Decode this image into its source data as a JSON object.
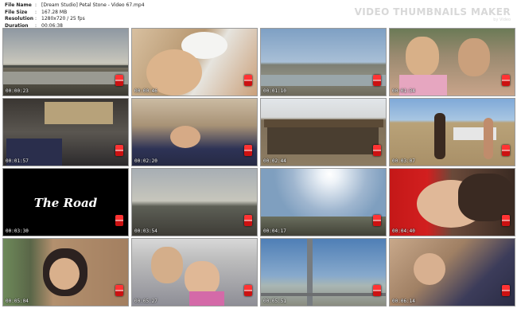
{
  "header": {
    "file_name_key": "File Name",
    "file_name_sep": ":",
    "file_name": "[Dream Studio] Petal Stone - Video 67.mp4",
    "file_size_key": "File Size",
    "file_size_sep": ":",
    "file_size": "167.28 MB",
    "resolution_key": "Resolution",
    "resolution_sep": ":",
    "resolution": "1280x720 / 25 fps",
    "duration_key": "Duration",
    "duration_sep": ":",
    "duration": "00:06:38"
  },
  "brand": {
    "title": "VIDEO THUMBNAILS MAKER",
    "subtitle": "by Video"
  },
  "thumbnails": [
    {
      "timestamp": "00:00:23",
      "icon": "studio-logo-icon",
      "scene": "sea-dusk"
    },
    {
      "timestamp": "00:00:46",
      "icon": "studio-logo-icon",
      "scene": "girl-cap-sleep"
    },
    {
      "timestamp": "00:01:10",
      "icon": "studio-logo-icon",
      "scene": "shore"
    },
    {
      "timestamp": "00:01:34",
      "icon": "studio-logo-icon",
      "scene": "two-girls-car"
    },
    {
      "timestamp": "00:01:57",
      "icon": "studio-logo-icon",
      "scene": "car-backseat"
    },
    {
      "timestamp": "00:02:20",
      "icon": "studio-logo-icon",
      "scene": "sleep-car"
    },
    {
      "timestamp": "00:02:44",
      "icon": "studio-logo-icon",
      "scene": "shed"
    },
    {
      "timestamp": "00:03:07",
      "icon": "studio-logo-icon",
      "scene": "beach-people"
    },
    {
      "timestamp": "00:03:30",
      "icon": "studio-logo-icon",
      "scene": "title-card",
      "title": "The Road"
    },
    {
      "timestamp": "00:03:54",
      "icon": "studio-logo-icon",
      "scene": "road-view"
    },
    {
      "timestamp": "00:04:17",
      "icon": "studio-logo-icon",
      "scene": "sun-sky"
    },
    {
      "timestamp": "00:04:40",
      "icon": "studio-logo-icon",
      "scene": "girl-sleep-red"
    },
    {
      "timestamp": "00:05:04",
      "icon": "studio-logo-icon",
      "scene": "girl-window"
    },
    {
      "timestamp": "00:05:27",
      "icon": "studio-logo-icon",
      "scene": "girls-wave"
    },
    {
      "timestamp": "00:05:51",
      "icon": "studio-logo-icon",
      "scene": "bridge"
    },
    {
      "timestamp": "00:06:14",
      "icon": "studio-logo-icon",
      "scene": "sleep-end"
    }
  ]
}
